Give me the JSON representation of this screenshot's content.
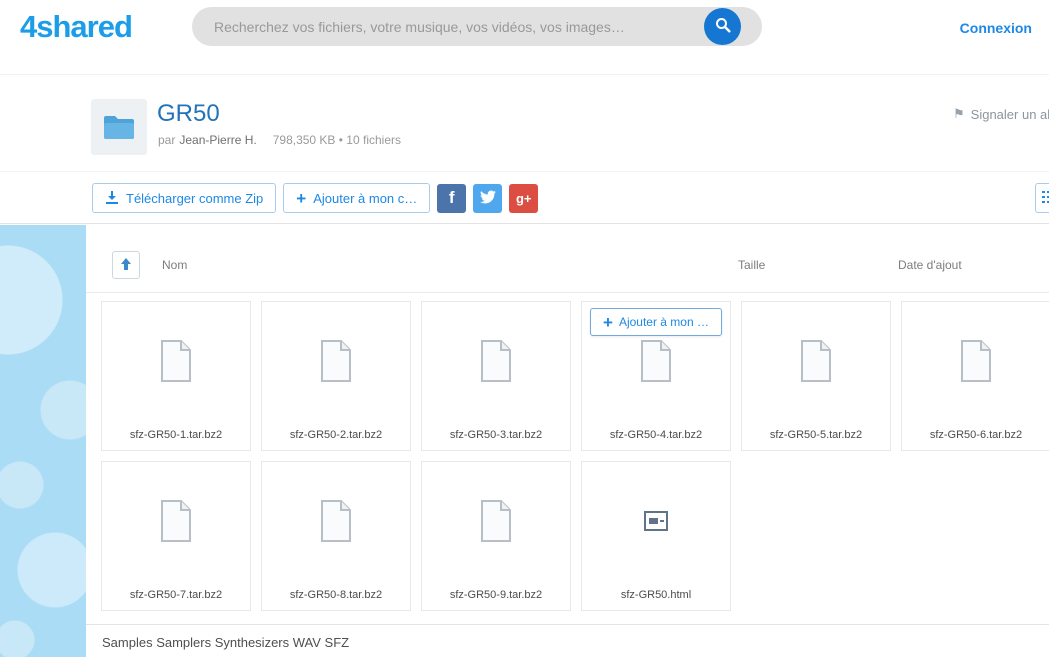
{
  "header": {
    "logo_part1": "4",
    "logo_part2": "shared",
    "search_placeholder": "Recherchez vos fichiers, votre musique, vos vidéos, vos images…",
    "login_label": "Connexion"
  },
  "folder": {
    "title": "GR50",
    "by_label": "par",
    "owner": "Jean-Pierre H.",
    "stats": "798,350 KB • 10 fichiers",
    "report_label": "Signaler un abus"
  },
  "toolbar": {
    "download_zip_label": "Télécharger comme Zip",
    "add_label": "Ajouter à mon c…",
    "social": [
      {
        "name": "facebook",
        "glyph": "f",
        "color": "#4b74ab"
      },
      {
        "name": "twitter",
        "color": "#4fa8ee"
      },
      {
        "name": "googleplus",
        "glyph": "g+",
        "color": "#dc4e41"
      }
    ]
  },
  "table_header": {
    "name_col": "Nom",
    "size_col": "Taille",
    "date_col": "Date d'ajout"
  },
  "grid": {
    "add_button_label": "Ajouter à mon …"
  },
  "files": [
    {
      "name": "sfz-GR50-1.tar.bz2",
      "type": "archive"
    },
    {
      "name": "sfz-GR50-2.tar.bz2",
      "type": "archive"
    },
    {
      "name": "sfz-GR50-3.tar.bz2",
      "type": "archive"
    },
    {
      "name": "sfz-GR50-4.tar.bz2",
      "type": "archive",
      "show_add_button": true
    },
    {
      "name": "sfz-GR50-5.tar.bz2",
      "type": "archive"
    },
    {
      "name": "sfz-GR50-6.tar.bz2",
      "type": "archive"
    },
    {
      "name": "sfz-GR50-7.tar.bz2",
      "type": "archive"
    },
    {
      "name": "sfz-GR50-8.tar.bz2",
      "type": "archive"
    },
    {
      "name": "sfz-GR50-9.tar.bz2",
      "type": "archive"
    },
    {
      "name": "sfz-GR50.html",
      "type": "html"
    }
  ],
  "footer": {
    "tags": "Samples Samplers Synthesizers WAV SFZ"
  },
  "colors": {
    "accent": "#1e88e5",
    "logo": "#1b9de8",
    "search_button": "#1577d2",
    "facebook": "#4b74ab",
    "twitter": "#4fa8ee",
    "googleplus": "#dc4e41",
    "left_background": "#aadcf5"
  }
}
